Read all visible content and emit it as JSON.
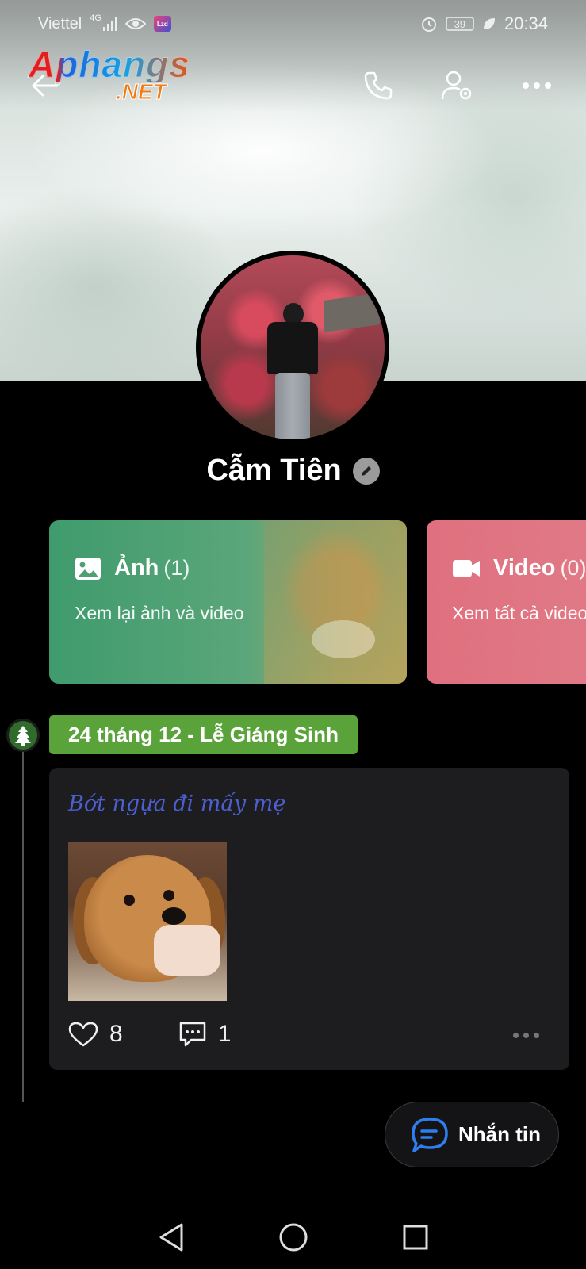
{
  "status_bar": {
    "carrier": "Viettel",
    "network": "4G",
    "battery": "39",
    "time": "20:34"
  },
  "logo": {
    "main": "Aphangs",
    "sub": ".NET"
  },
  "profile": {
    "name": "Cẫm Tiên"
  },
  "media_cards": {
    "photos": {
      "title": "Ảnh",
      "count": "(1)",
      "subtitle": "Xem lại ảnh và video"
    },
    "videos": {
      "title": "Video",
      "count": "(0)",
      "subtitle": "Xem tất cả video"
    }
  },
  "timeline": {
    "event_label": "24 tháng 12 - Lễ Giáng Sinh"
  },
  "post": {
    "text": "Bớt ngựa đi mấy mẹ",
    "likes": "8",
    "comments": "1"
  },
  "message_button": {
    "label": "Nhắn tin"
  },
  "colors": {
    "photos_card": "#3f9b6d",
    "videos_card": "#e0707f",
    "event_badge": "#5aa23a",
    "post_text": "#4b5fd0",
    "message_icon": "#2d7ff0"
  },
  "icons": {
    "back": "back-arrow-icon",
    "call": "phone-icon",
    "profile_settings": "user-settings-icon",
    "more": "more-horizontal-icon",
    "edit": "pencil-icon",
    "photo": "image-icon",
    "video": "video-camera-icon",
    "tree": "christmas-tree-icon",
    "like": "heart-icon",
    "comment": "comment-icon",
    "message": "chat-bubble-icon"
  }
}
